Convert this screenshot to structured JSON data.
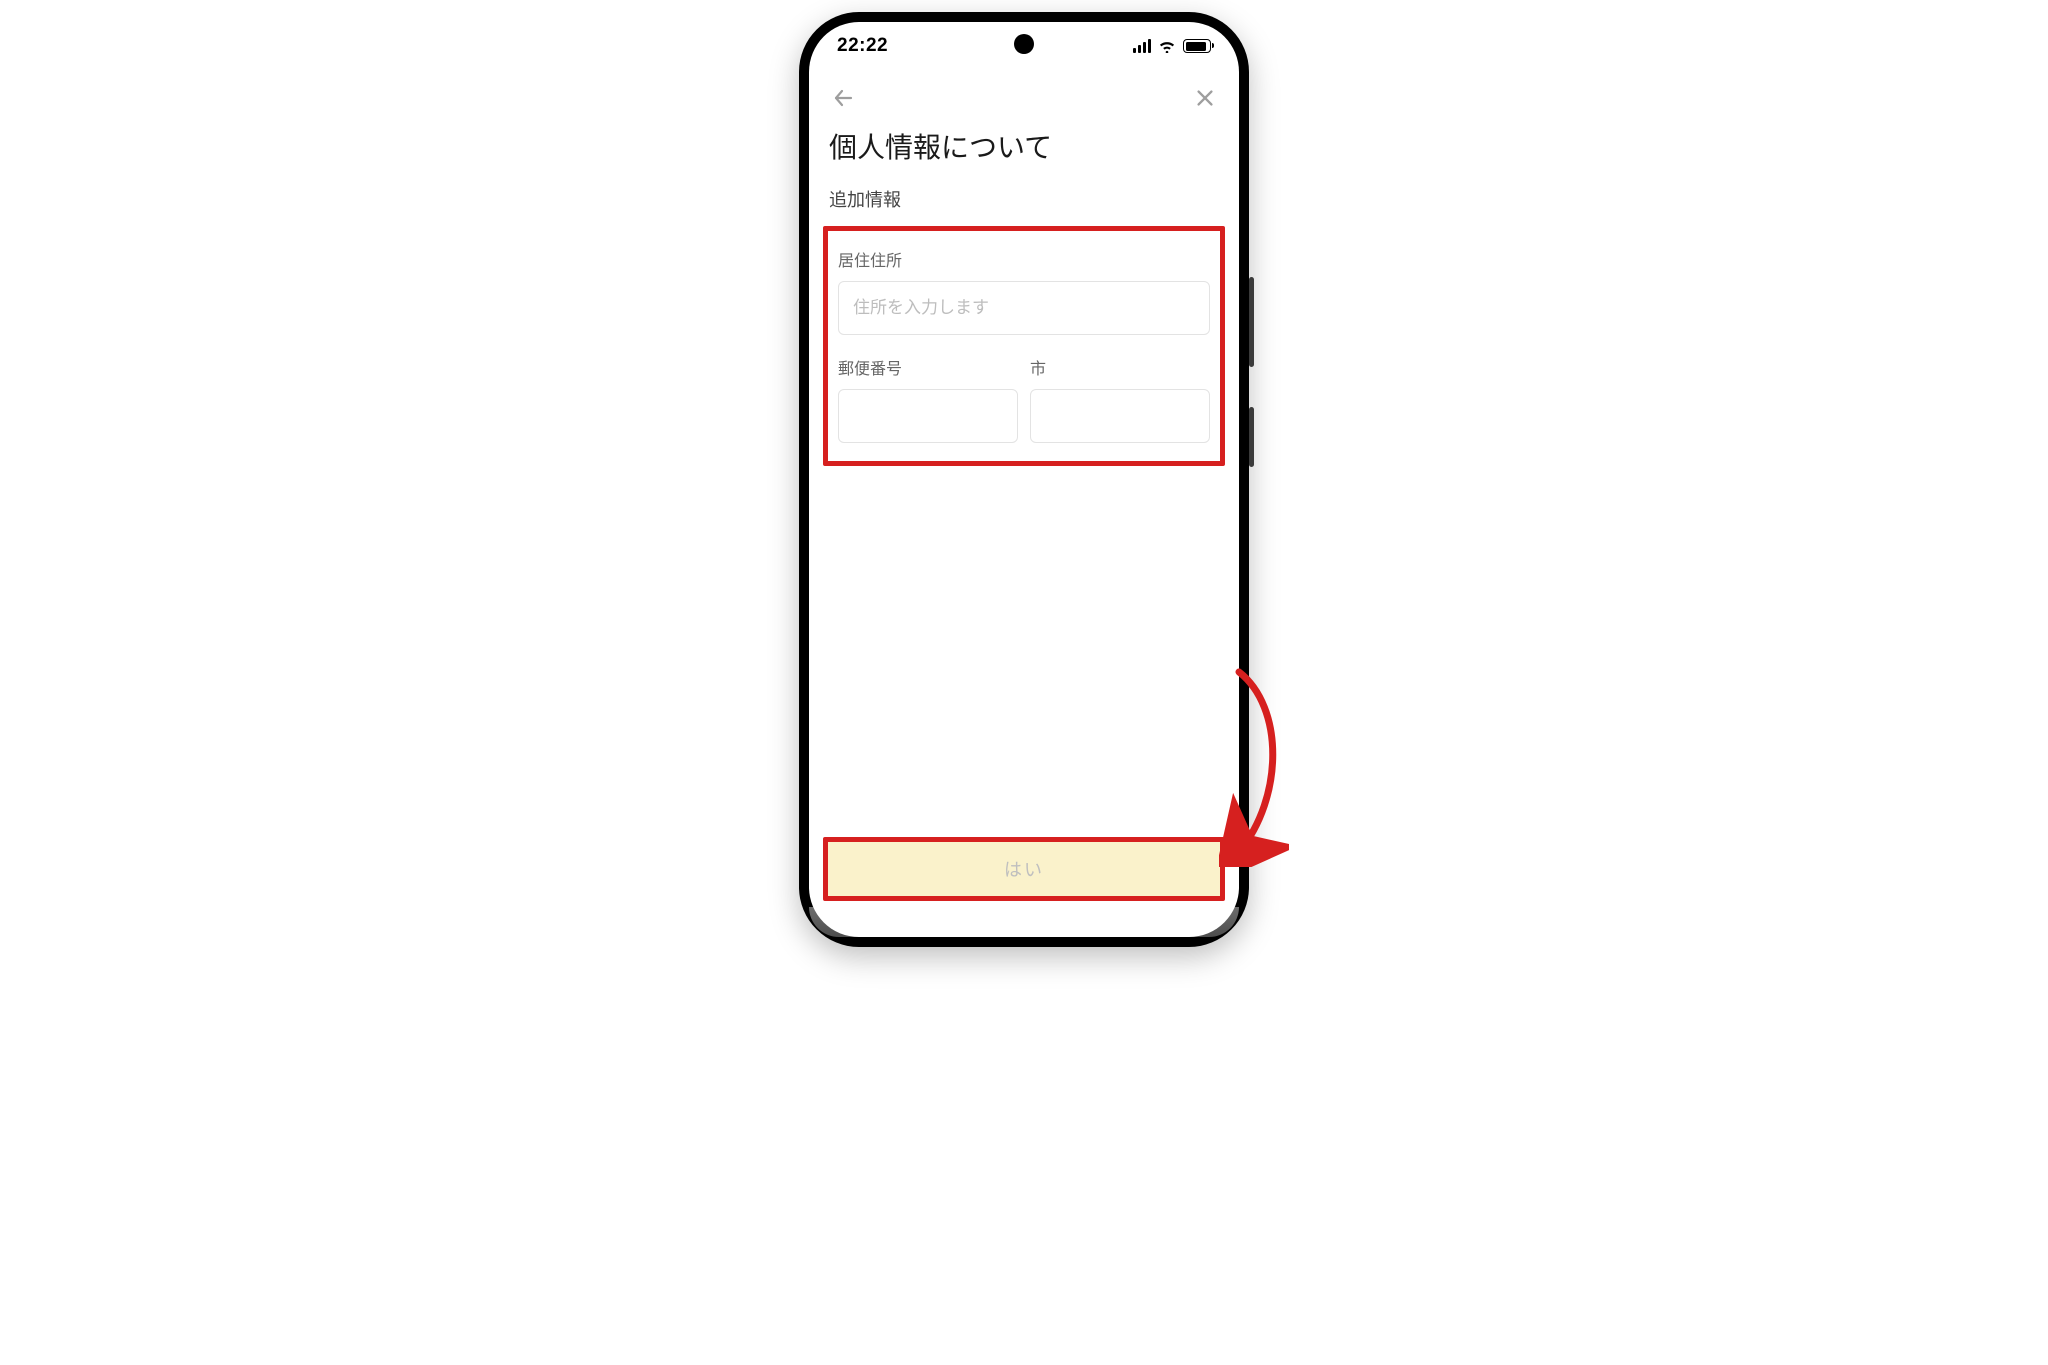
{
  "status": {
    "time": "22:22"
  },
  "page": {
    "title": "個人情報について",
    "subtitle": "追加情報"
  },
  "form": {
    "address": {
      "label": "居住住所",
      "placeholder": "住所を入力します",
      "value": ""
    },
    "postal": {
      "label": "郵便番号",
      "value": ""
    },
    "city": {
      "label": "市",
      "value": ""
    }
  },
  "cta": {
    "label": "はい"
  },
  "colors": {
    "highlight": "#d6201f",
    "ctaBg": "#faf2cb"
  }
}
